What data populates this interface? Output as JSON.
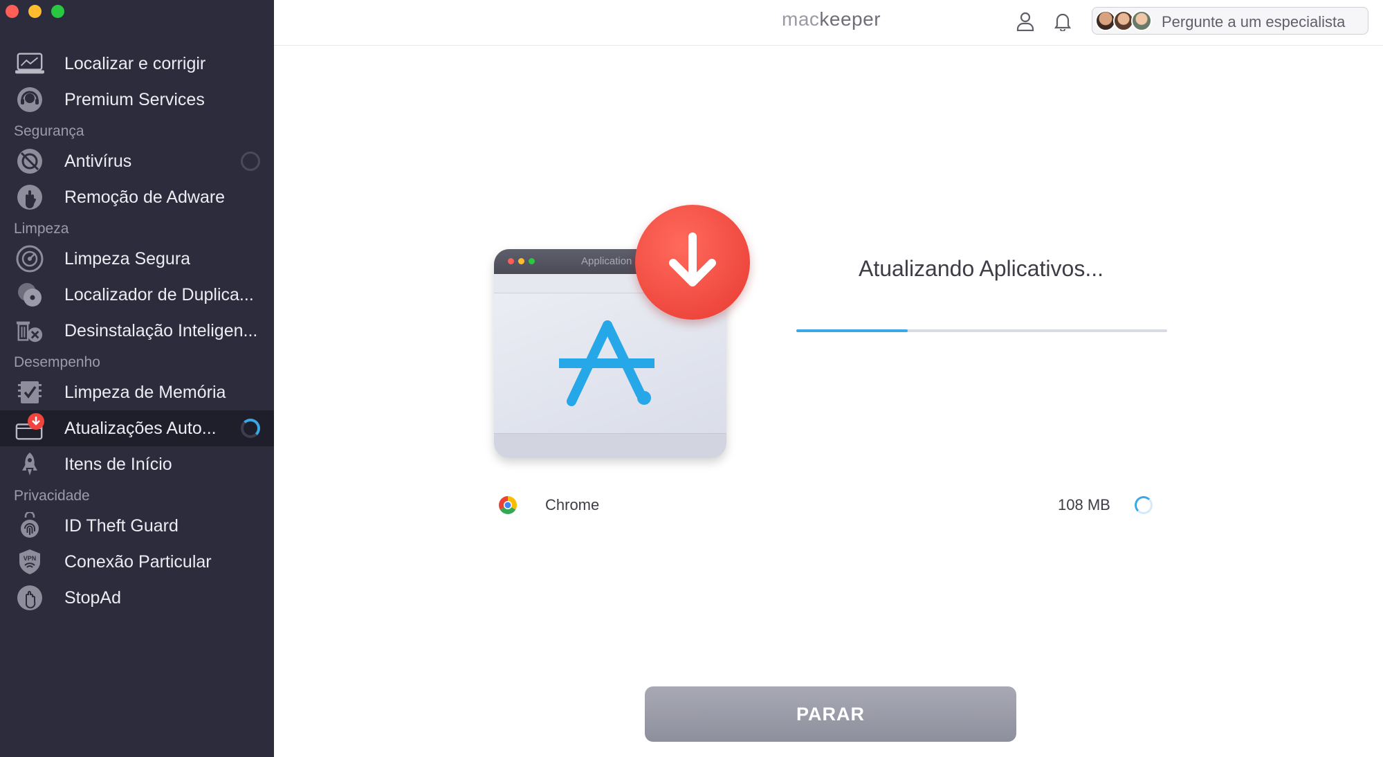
{
  "window": {
    "controls": [
      "close",
      "minimize",
      "zoom"
    ]
  },
  "sidebar": {
    "items_top": [
      {
        "label": "Localizar e corrigir",
        "icon": "laptop-scan-icon"
      },
      {
        "label": "Premium Services",
        "icon": "headset-icon"
      }
    ],
    "sections": [
      {
        "title": "Segurança",
        "items": [
          {
            "label": "Antivírus",
            "icon": "antivirus-icon",
            "status": "idle-ring"
          },
          {
            "label": "Remoção de Adware",
            "icon": "hand-stop-icon"
          }
        ]
      },
      {
        "title": "Limpeza",
        "items": [
          {
            "label": "Limpeza Segura",
            "icon": "disk-clean-icon"
          },
          {
            "label": "Localizador de Duplica...",
            "icon": "duplicates-icon"
          },
          {
            "label": "Desinstalação Inteligen...",
            "icon": "uninstall-icon"
          }
        ]
      },
      {
        "title": "Desempenho",
        "items": [
          {
            "label": "Limpeza de Memória",
            "icon": "memory-check-icon"
          },
          {
            "label": "Atualizações Auto...",
            "icon": "updates-icon",
            "active": true,
            "badge": "!",
            "status": "spinner"
          },
          {
            "label": "Itens de Início",
            "icon": "rocket-icon"
          }
        ]
      },
      {
        "title": "Privacidade",
        "items": [
          {
            "label": "ID Theft Guard",
            "icon": "fingerprint-icon"
          },
          {
            "label": "Conexão Particular",
            "icon": "vpn-shield-icon"
          },
          {
            "label": "StopAd",
            "icon": "stopad-hand-icon"
          }
        ]
      }
    ]
  },
  "topbar": {
    "brand_mac": "mac",
    "brand_keeper": "keeper",
    "expert_label": "Pergunte a um especialista"
  },
  "main": {
    "app_window_title": "Application",
    "status_title": "Atualizando Aplicativos...",
    "progress_fraction": 0.3,
    "apps": [
      {
        "name": "Chrome",
        "size": "108 MB",
        "icon": "chrome-icon",
        "state": "updating"
      }
    ],
    "stop_label": "PARAR"
  },
  "colors": {
    "sidebar_bg": "#2c2c3c",
    "accent_blue": "#3aa7e6",
    "alert_red": "#e83a32",
    "button_gray": "#9b9ca8"
  }
}
